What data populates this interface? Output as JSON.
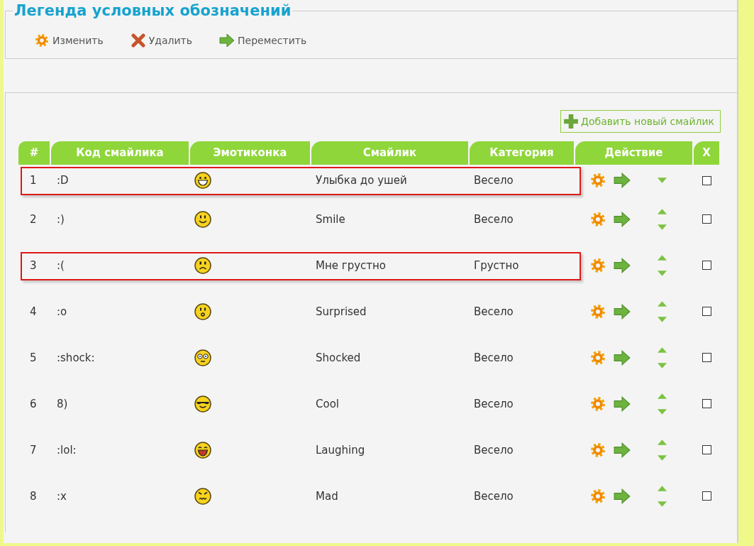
{
  "legend": {
    "title": "Легенда условных обозначений",
    "items": [
      {
        "kind": "edit",
        "label": "Изменить"
      },
      {
        "kind": "delete",
        "label": "Удалить"
      },
      {
        "kind": "move",
        "label": "Переместить"
      }
    ]
  },
  "add_button": {
    "label": "Добавить новый смайлик"
  },
  "table": {
    "columns": [
      "#",
      "Код смайлика",
      "Эмотиконка",
      "Смайлик",
      "Категория",
      "Действие",
      "X"
    ],
    "rows": [
      {
        "number": "1",
        "code": ":D",
        "kind": "grin",
        "name": "Улыбка до ушей",
        "category": "Весело",
        "highlighted": true,
        "can_move_up": false,
        "checked": false
      },
      {
        "number": "2",
        "code": ":)",
        "kind": "smile",
        "name": "Smile",
        "category": "Весело",
        "highlighted": false,
        "can_move_up": true,
        "checked": false
      },
      {
        "number": "3",
        "code": ":(",
        "kind": "sad",
        "name": "Мне грустно",
        "category": "Грустно",
        "highlighted": true,
        "can_move_up": true,
        "checked": false
      },
      {
        "number": "4",
        "code": ":o",
        "kind": "surprised",
        "name": "Surprised",
        "category": "Весело",
        "highlighted": false,
        "can_move_up": true,
        "checked": false
      },
      {
        "number": "5",
        "code": ":shock:",
        "kind": "shocked",
        "name": "Shocked",
        "category": "Весело",
        "highlighted": false,
        "can_move_up": true,
        "checked": false
      },
      {
        "number": "6",
        "code": "8)",
        "kind": "cool",
        "name": "Cool",
        "category": "Весело",
        "highlighted": false,
        "can_move_up": true,
        "checked": false
      },
      {
        "number": "7",
        "code": ":lol:",
        "kind": "laugh",
        "name": "Laughing",
        "category": "Весело",
        "highlighted": false,
        "can_move_up": true,
        "checked": false
      },
      {
        "number": "8",
        "code": ":x",
        "kind": "mad",
        "name": "Mad",
        "category": "Весело",
        "highlighted": false,
        "can_move_up": true,
        "checked": false
      }
    ]
  }
}
